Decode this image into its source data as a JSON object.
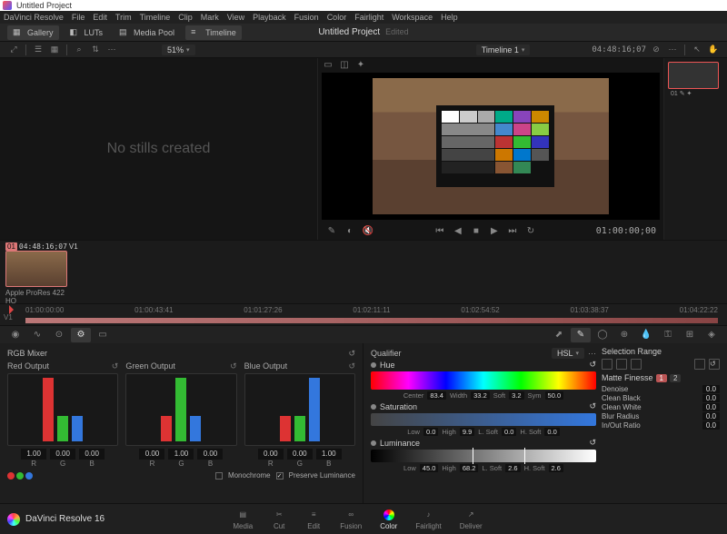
{
  "window": {
    "title": "Untitled Project"
  },
  "menu": [
    "DaVinci Resolve",
    "File",
    "Edit",
    "Trim",
    "Timeline",
    "Clip",
    "Mark",
    "View",
    "Playback",
    "Fusion",
    "Color",
    "Fairlight",
    "Workspace",
    "Help"
  ],
  "toolbar1": {
    "gallery": "Gallery",
    "luts": "LUTs",
    "mediapool": "Media Pool",
    "timeline": "Timeline"
  },
  "toolbar2": {
    "zoom": "51%",
    "timeline_name": "Timeline 1",
    "master_tc": "04:48:16;07"
  },
  "project": {
    "title": "Untitled Project",
    "status": "Edited"
  },
  "stills": {
    "empty": "No stills created"
  },
  "viewer": {
    "tc": "01:00:00;00"
  },
  "node": {
    "label": "01"
  },
  "clip": {
    "badge": "01",
    "tc": "04:48:16;07",
    "track": "V1",
    "codec": "Apple ProRes 422 HQ"
  },
  "timeline": {
    "track": "V1",
    "ticks": [
      "01:00:00:00",
      "01:00:43:41",
      "01:01:27:26",
      "01:02:11:11",
      "01:02:54:52",
      "01:03:38:37",
      "01:04:22:22"
    ]
  },
  "mixer": {
    "title": "RGB Mixer",
    "red": {
      "label": "Red Output",
      "vals": [
        "1.00",
        "0.00",
        "0.00"
      ]
    },
    "green": {
      "label": "Green Output",
      "vals": [
        "0.00",
        "1.00",
        "0.00"
      ]
    },
    "blue": {
      "label": "Blue Output",
      "vals": [
        "0.00",
        "0.00",
        "1.00"
      ]
    },
    "rgb": [
      "R",
      "G",
      "B"
    ],
    "mono": "Monochrome",
    "preserve": "Preserve Luminance"
  },
  "qualifier": {
    "title": "Qualifier",
    "mode": "HSL",
    "hue": {
      "label": "Hue",
      "center_l": "Center",
      "center": "83.4",
      "width_l": "Width",
      "width": "33.2",
      "soft_l": "Soft",
      "soft": "3.2",
      "sym_l": "Sym",
      "sym": "50.0"
    },
    "sat": {
      "label": "Saturation",
      "low_l": "Low",
      "low": "0.0",
      "high_l": "High",
      "high": "9.9",
      "ls_l": "L. Soft",
      "ls": "0.0",
      "hs_l": "H. Soft",
      "hs": "0.0"
    },
    "lum": {
      "label": "Luminance",
      "low_l": "Low",
      "low": "45.0",
      "high_l": "High",
      "high": "68.2",
      "ls_l": "L. Soft",
      "ls": "2.6",
      "hs_l": "H. Soft",
      "hs": "2.6"
    },
    "sel": "Selection Range",
    "finesse": {
      "title": "Matte Finesse",
      "pills": [
        "1",
        "2"
      ],
      "denoise_l": "Denoise",
      "denoise": "0.0",
      "cblack_l": "Clean Black",
      "cblack": "0.0",
      "cwhite_l": "Clean White",
      "cwhite": "0.0",
      "blur_l": "Blur Radius",
      "blur": "0.0",
      "ratio_l": "In/Out Ratio",
      "ratio": "0.0"
    }
  },
  "pages": {
    "media": "Media",
    "cut": "Cut",
    "edit": "Edit",
    "fusion": "Fusion",
    "color": "Color",
    "fairlight": "Fairlight",
    "deliver": "Deliver"
  },
  "app": {
    "name": "DaVinci Resolve 16"
  }
}
